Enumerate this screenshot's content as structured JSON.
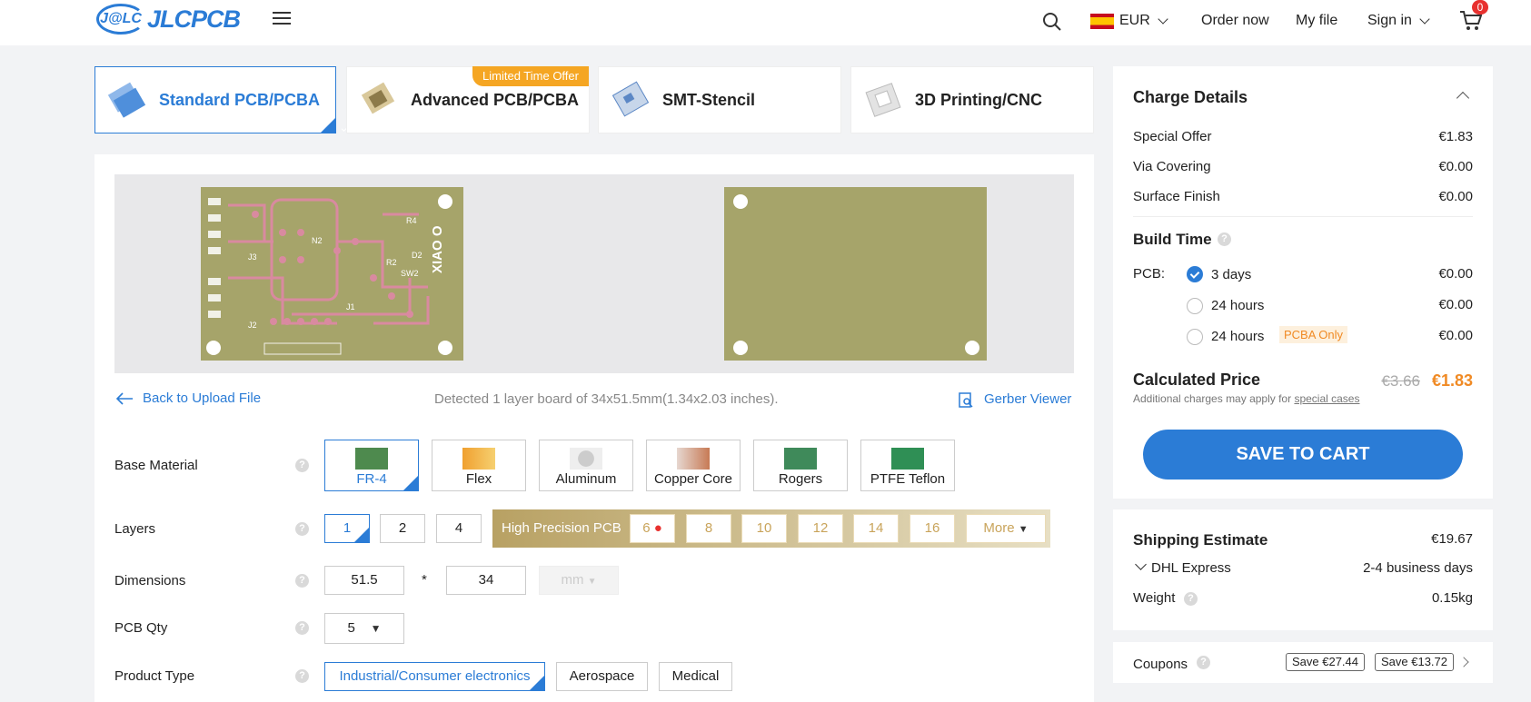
{
  "header": {
    "logo_mark": "J@LC",
    "logo_text": "JLCPCB",
    "currency": "EUR",
    "order_now": "Order now",
    "my_file": "My file",
    "sign_in": "Sign in",
    "cart_count": "0"
  },
  "tabs": [
    {
      "label": "Standard PCB/PCBA"
    },
    {
      "label": "Advanced PCB/PCBA"
    },
    {
      "label": "SMT-Stencil"
    },
    {
      "label": "3D Printing/CNC"
    }
  ],
  "ribbon": "Limited Time Offer",
  "preview": {
    "silk_labels": [
      "J3",
      "N2",
      "R4",
      "D2",
      "R2",
      "SW2",
      "J2",
      "J1",
      "XIAO O"
    ]
  },
  "file": {
    "back": "Back to Upload File",
    "detected": "Detected 1 layer board of 34x51.5mm(1.34x2.03 inches).",
    "gerber": "Gerber Viewer"
  },
  "options": {
    "base_material": {
      "label": "Base Material",
      "items": [
        "FR-4",
        "Flex",
        "Aluminum",
        "Copper Core",
        "Rogers",
        "PTFE Teflon"
      ]
    },
    "layers": {
      "label": "Layers",
      "items": [
        "1",
        "2",
        "4"
      ],
      "hp_label": "High Precision PCB",
      "hp_items": [
        "6",
        "8",
        "10",
        "12",
        "14",
        "16"
      ],
      "more": "More"
    },
    "dimensions": {
      "label": "Dimensions",
      "w": "51.5",
      "sep": "*",
      "h": "34",
      "unit": "mm"
    },
    "qty": {
      "label": "PCB Qty",
      "value": "5"
    },
    "product_type": {
      "label": "Product Type",
      "items": [
        "Industrial/Consumer electronics",
        "Aerospace",
        "Medical"
      ]
    }
  },
  "charge": {
    "title": "Charge Details",
    "rows": [
      {
        "label": "Special Offer",
        "value": "€1.83"
      },
      {
        "label": "Via Covering",
        "value": "€0.00"
      },
      {
        "label": "Surface Finish",
        "value": "€0.00"
      }
    ],
    "build_title": "Build Time",
    "pcb_label": "PCB:",
    "build": [
      {
        "label": "3 days",
        "value": "€0.00"
      },
      {
        "label": "24 hours",
        "value": "€0.00"
      },
      {
        "label": "24 hours",
        "value": "€0.00",
        "tag": "PCBA Only"
      }
    ],
    "calc_label": "Calculated Price",
    "old_price": "€3.66",
    "price": "€1.83",
    "note": "Additional charges may apply for",
    "note_link": "special cases",
    "save": "SAVE TO CART"
  },
  "shipping": {
    "title": "Shipping Estimate",
    "price": "€19.67",
    "method": "DHL Express",
    "days": "2-4 business days",
    "weight_label": "Weight",
    "weight": "0.15kg"
  },
  "coupons": {
    "label": "Coupons",
    "items": [
      "Save €27.44",
      "Save €13.72"
    ]
  },
  "colors": {
    "accent": "#2b7cd6",
    "orange": "#f08a24",
    "pcb": "#a6a46a"
  }
}
